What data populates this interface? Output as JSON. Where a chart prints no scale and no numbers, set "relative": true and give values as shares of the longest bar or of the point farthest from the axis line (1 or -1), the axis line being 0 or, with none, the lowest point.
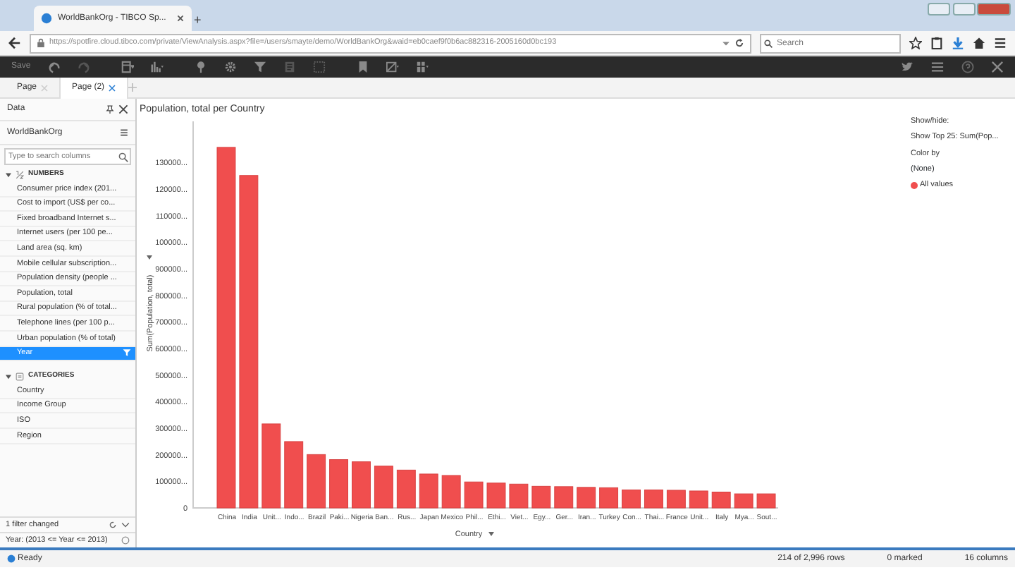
{
  "browser": {
    "tab_title": "WorldBankOrg - TIBCO Sp...",
    "new_tab": "+",
    "url": "https://spotfire.cloud.tibco.com/private/ViewAnalysis.aspx?file=/users/smayte/demo/WorldBankOrg&waid=eb0caef9f0b6ac882316-2005160d0bc193",
    "search_placeholder": "Search"
  },
  "toolbar": {
    "save": "Save"
  },
  "pages": [
    {
      "label": "Page",
      "selected": false
    },
    {
      "label": "Page (2)",
      "selected": true
    }
  ],
  "data_panel": {
    "title": "Data",
    "source": "WorldBankOrg",
    "search_placeholder": "Type to search columns",
    "groups": [
      {
        "label": "NUMBERS",
        "kind": "numbers",
        "expanded": true,
        "items": [
          {
            "label": "Consumer price index (201...",
            "selected": false,
            "filtered": false
          },
          {
            "label": "Cost to import (US$ per co...",
            "selected": false,
            "filtered": false
          },
          {
            "label": "Fixed broadband Internet s...",
            "selected": false,
            "filtered": false
          },
          {
            "label": "Internet users (per 100 pe...",
            "selected": false,
            "filtered": false
          },
          {
            "label": "Land area (sq. km)",
            "selected": false,
            "filtered": false
          },
          {
            "label": "Mobile cellular subscription...",
            "selected": false,
            "filtered": false
          },
          {
            "label": "Population density (people ...",
            "selected": false,
            "filtered": false
          },
          {
            "label": "Population, total",
            "selected": false,
            "filtered": false
          },
          {
            "label": "Rural population (% of total...",
            "selected": false,
            "filtered": false
          },
          {
            "label": "Telephone lines (per 100 p...",
            "selected": false,
            "filtered": false
          },
          {
            "label": "Urban population (% of total)",
            "selected": false,
            "filtered": false
          },
          {
            "label": "Year",
            "selected": true,
            "filtered": true
          }
        ]
      },
      {
        "label": "CATEGORIES",
        "kind": "categories",
        "expanded": true,
        "items": [
          {
            "label": "Country",
            "selected": false,
            "filtered": false
          },
          {
            "label": "Income Group",
            "selected": false,
            "filtered": false
          },
          {
            "label": "ISO",
            "selected": false,
            "filtered": false
          },
          {
            "label": "Region",
            "selected": false,
            "filtered": false
          }
        ]
      }
    ],
    "filter_summary": "1 filter changed",
    "filter_expression": "Year: (2013 <= Year <= 2013)"
  },
  "chart": {
    "chart_data": {
      "type": "bar",
      "relative": true,
      "title": "Population, total per Country",
      "xlabel": "Country",
      "ylabel": "Sum(Population, total)",
      "categories": [
        "China",
        "India",
        "Unit...",
        "Indo...",
        "Brazil",
        "Paki...",
        "Nigeria",
        "Ban...",
        "Rus...",
        "Japan",
        "Mexico",
        "Phil...",
        "Ethi...",
        "Viet...",
        "Egy...",
        "Ger...",
        "Iran...",
        "Turkey",
        "Con...",
        "Thai...",
        "France",
        "Unit...",
        "Italy",
        "Mya...",
        "Sout..."
      ],
      "series": [
        {
          "name": "All values",
          "color": "#f04e4e",
          "values": [
            1,
            0.922,
            0.233,
            0.184,
            0.148,
            0.134,
            0.128,
            0.116,
            0.105,
            0.094,
            0.09,
            0.072,
            0.069,
            0.066,
            0.06,
            0.059,
            0.057,
            0.056,
            0.05,
            0.05,
            0.049,
            0.047,
            0.044,
            0.039,
            0.039
          ]
        }
      ]
    },
    "y_tick_labels": [
      "130000...",
      "120000...",
      "110000...",
      "100000...",
      "900000...",
      "800000...",
      "700000...",
      "600000...",
      "500000...",
      "400000...",
      "300000...",
      "200000...",
      "100000...",
      "0"
    ]
  },
  "legend": {
    "heading": "Show/hide:",
    "show_item": "Show Top 25: Sum(Pop...",
    "color_by": "Color by",
    "color_value": "(None)"
  },
  "status": {
    "state": "Ready",
    "rows": "214 of 2,996 rows",
    "marked": "0 marked",
    "columns": "16 columns"
  }
}
